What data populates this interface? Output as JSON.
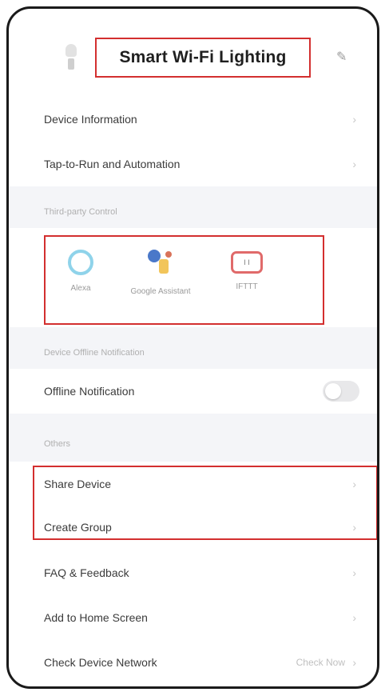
{
  "header": {
    "title": "Smart Wi-Fi Lighting",
    "edit_icon": "pencil-icon"
  },
  "device_info": {
    "label": "Device Information",
    "tap_label": "Tap-to-Run and Automation"
  },
  "integrations": {
    "section_label": "Third-party Control",
    "items": [
      {
        "label": "Alexa",
        "icon": "alexa-icon"
      },
      {
        "label": "Google Assistant",
        "icon": "google-assistant-icon"
      },
      {
        "label": "IFTTT",
        "icon": "ifttt-icon"
      }
    ]
  },
  "offline": {
    "section_label": "Device Offline Notification",
    "label": "Offline Notification",
    "enabled": false
  },
  "others": {
    "section_label": "Others",
    "share_device": "Share Device",
    "create_group": "Create Group",
    "faq": "FAQ & Feedback",
    "add_home": "Add to Home Screen",
    "check_network": "Check Device Network",
    "check_network_value": "Check Now"
  },
  "colors": {
    "highlight": "#d32f2f"
  }
}
